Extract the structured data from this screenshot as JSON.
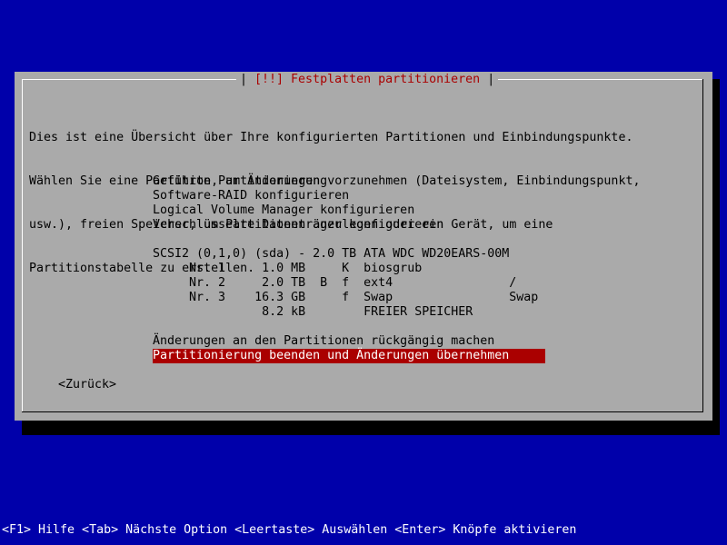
{
  "dialog": {
    "title": "[!!] Festplatten partitionieren",
    "intro_lines": [
      "Dies ist eine Übersicht über Ihre konfigurierten Partitionen und Einbindungspunkte.",
      "Wählen Sie eine Partition, um Änderungen vorzunehmen (Dateisystem, Einbindungspunkt,",
      "usw.), freien Speicher, um Partitionen anzulegen oder ein Gerät, um eine",
      "Partitionstabelle zu erstellen."
    ],
    "actions": [
      "Geführte Partitionierung",
      "Software-RAID konfigurieren",
      "Logical Volume Manager konfigurieren",
      "Verschlüsselte Datenträger konfigurieren"
    ],
    "disk": "SCSI2 (0,1,0) (sda) - 2.0 TB ATA WDC WD20EARS-00M",
    "partitions": [
      "     Nr. 1     1.0 MB     K  biosgrub",
      "     Nr. 2     2.0 TB  B  f  ext4                /",
      "     Nr. 3    16.3 GB     f  Swap                Swap",
      "               8.2 kB        FREIER SPEICHER"
    ],
    "undo_label": "Änderungen an den Partitionen rückgängig machen",
    "finish_label": "Partitionierung beenden und Änderungen übernehmen",
    "back_label": "<Zurück>"
  },
  "statusbar": {
    "text": "<F1> Hilfe <Tab> Nächste Option <Leertaste> Auswählen <Enter> Knöpfe aktivieren"
  },
  "colors": {
    "background": "#0000aa",
    "dialog": "#aaaaaa",
    "selection": "#aa0000",
    "title": "#aa0000"
  }
}
